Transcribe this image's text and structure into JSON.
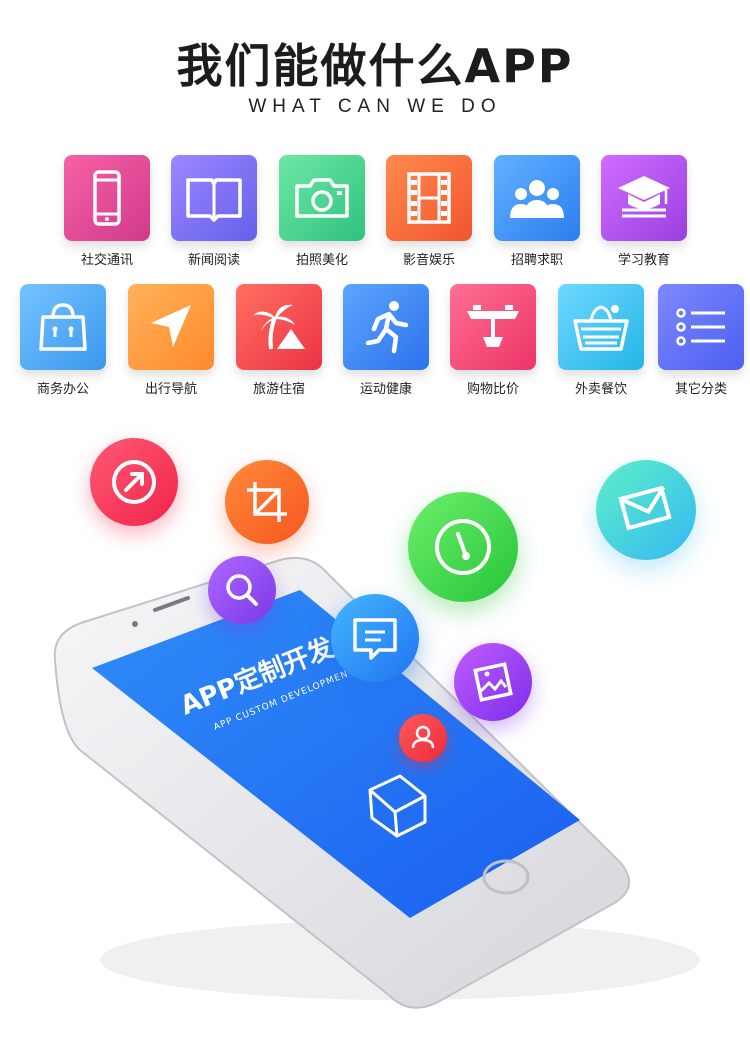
{
  "header": {
    "title": "我们能做什么APP",
    "subtitle": "WHAT CAN WE DO"
  },
  "categories": [
    {
      "label": "社交通讯",
      "icon": "phone-icon",
      "color": "#e8479a"
    },
    {
      "label": "新闻阅读",
      "icon": "book-icon",
      "color": "#7a70f0"
    },
    {
      "label": "拍照美化",
      "icon": "camera-icon",
      "color": "#3fd18e"
    },
    {
      "label": "影音娱乐",
      "icon": "film-icon",
      "color": "#ff6a3d"
    },
    {
      "label": "招聘求职",
      "icon": "people-icon",
      "color": "#3a8ef5"
    },
    {
      "label": "学习教育",
      "icon": "graduation-cap-icon",
      "color": "#b555e8"
    },
    {
      "label": "商务办公",
      "icon": "briefcase-icon",
      "color": "#4aaaf0"
    },
    {
      "label": "出行导航",
      "icon": "navigation-arrow-icon",
      "color": "#ff9a3c"
    },
    {
      "label": "旅游住宿",
      "icon": "palm-tree-icon",
      "color": "#f5464e"
    },
    {
      "label": "运动健康",
      "icon": "running-man-icon",
      "color": "#3b8af3"
    },
    {
      "label": "购物比价",
      "icon": "scale-icon",
      "color": "#f5457a"
    },
    {
      "label": "外卖餐饮",
      "icon": "basket-icon",
      "color": "#2fc4e8"
    },
    {
      "label": "其它分类",
      "icon": "list-icon",
      "color": "#5a6df5"
    }
  ],
  "phone": {
    "screen_title": "APP定制开发",
    "screen_subtitle": "APP CUSTOM DEVELOPMENT"
  },
  "bubbles": [
    "share-arrow-icon",
    "crop-icon",
    "search-icon",
    "speedometer-icon",
    "mail-icon",
    "message-icon",
    "image-icon",
    "user-icon"
  ]
}
